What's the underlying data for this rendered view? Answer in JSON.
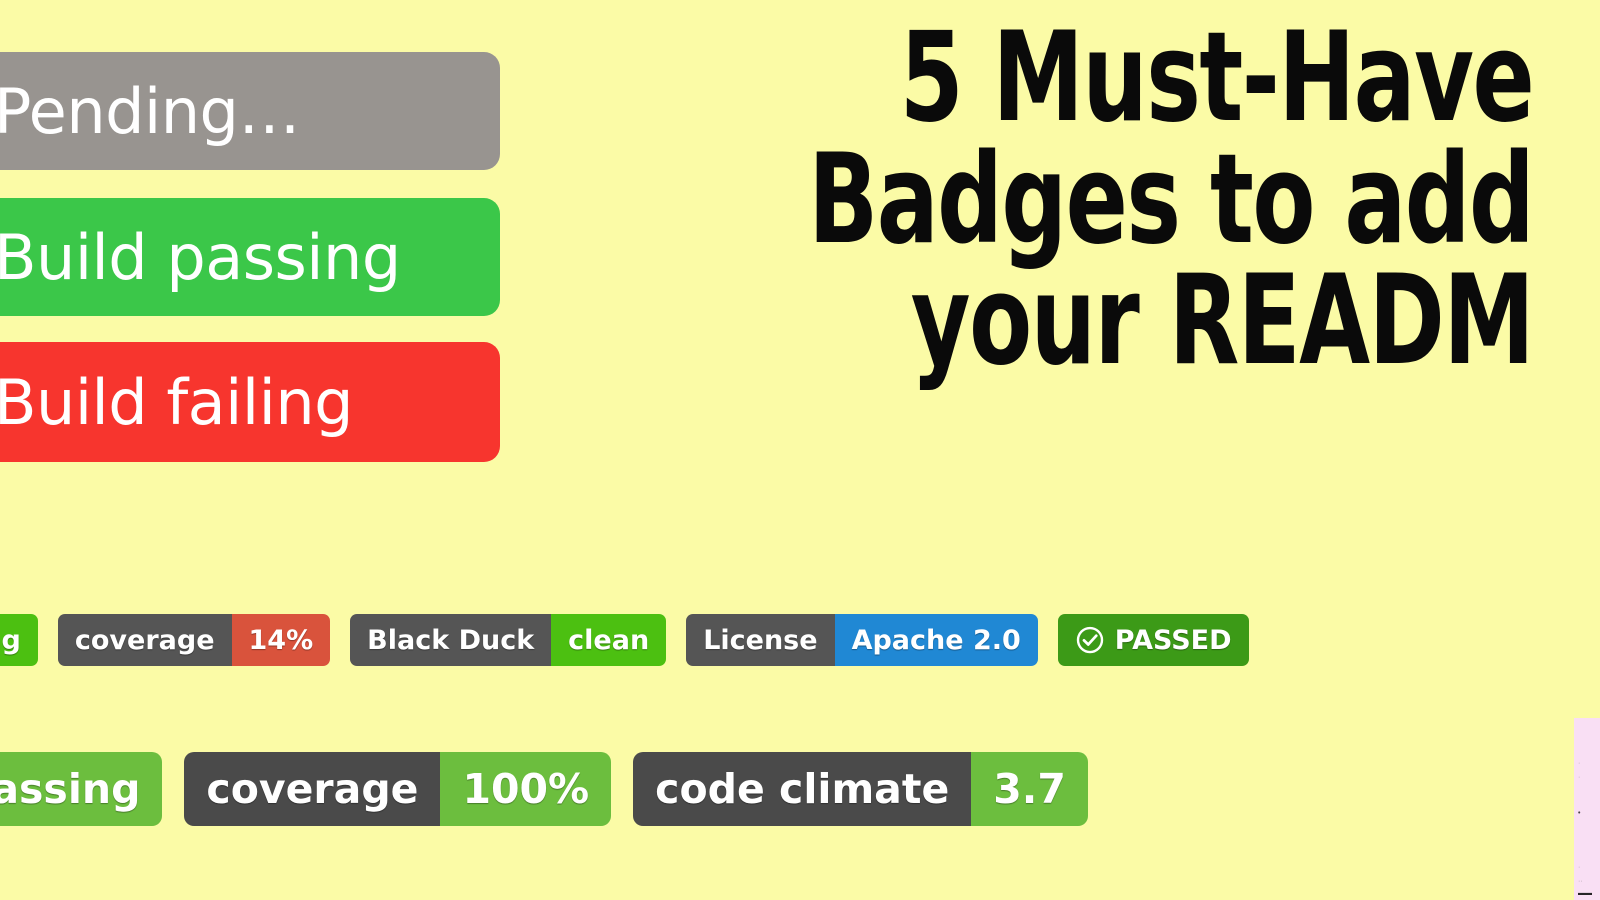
{
  "background_color": "#fbfba6",
  "headline": {
    "line1": "5 Must-Have",
    "line2": "Badges to add",
    "line3": "your READM"
  },
  "status_badges": [
    {
      "label": "Pending…",
      "color": "#989490",
      "state": "pending"
    },
    {
      "label": "Build passing",
      "color": "#3bc749",
      "state": "passing"
    },
    {
      "label": "Build failing",
      "color": "#f7352e",
      "state": "failing"
    }
  ],
  "badge_row_middle": [
    {
      "name": "build-badge",
      "left_label": "",
      "right_label": "sing",
      "left_color": "",
      "right_color": "#4cc011"
    },
    {
      "name": "coverage-badge",
      "left_label": "coverage",
      "right_label": "14%",
      "left_color": "#555555",
      "right_color": "#d9533c"
    },
    {
      "name": "black-duck-badge",
      "left_label": "Black Duck",
      "right_label": "clean",
      "left_color": "#555555",
      "right_color": "#4cc011"
    },
    {
      "name": "license-badge",
      "left_label": "License",
      "right_label": "Apache 2.0",
      "left_color": "#555555",
      "right_color": "#2088d4"
    },
    {
      "name": "passed-badge",
      "left_label": "",
      "right_label": "PASSED",
      "icon": "check-circle-icon",
      "left_color": "",
      "right_color": "#3c9a17"
    }
  ],
  "badge_row_bottom": [
    {
      "name": "build-badge",
      "left_label": "",
      "right_label": "passing",
      "left_color": "",
      "right_color": "#6cbe3e"
    },
    {
      "name": "coverage-badge",
      "left_label": "coverage",
      "right_label": "100%",
      "left_color": "#4a4a4a",
      "right_color": "#6cbe3e"
    },
    {
      "name": "code-climate-badge",
      "left_label": "code climate",
      "right_label": "3.7",
      "left_color": "#4a4a4a",
      "right_color": "#6cbe3e"
    }
  ],
  "right_edge_panel": {
    "color": "#f9dff4",
    "fragments": [
      "·",
      "·",
      "•",
      "·",
      "··",
      "▬▬"
    ]
  }
}
